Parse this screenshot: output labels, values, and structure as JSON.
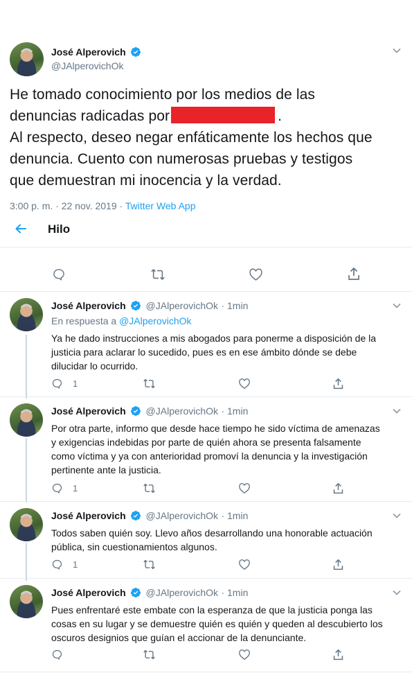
{
  "main_tweet": {
    "name": "José Alperovich",
    "handle": "@JAlperovichOk",
    "text_line1": "He tomado conocimiento por los medios de las",
    "text_line2a": "denuncias radicadas por",
    "text_line2b": ".",
    "text_line3": "Al respecto, deseo negar enfáticamente los hechos que",
    "text_line4": "denuncia. Cuento con numerosas pruebas y testigos",
    "text_line5": "que demuestran mi inocencia y  la verdad.",
    "timestamp": "3:00 p. m. · 22 nov. 2019 · ",
    "source": "Twitter Web App"
  },
  "thread_header": {
    "label": "Hilo"
  },
  "replies": [
    {
      "name": "José Alperovich",
      "handle": "@JAlperovichOk",
      "time": "· 1min",
      "in_reply_prefix": "En respuesta a ",
      "in_reply_handle": "@JAlperovichOk",
      "lines": [
        "Ya he dado instrucciones a mis abogados para ponerme a disposición de la",
        "justicia para aclarar lo sucedido, pues es en ese ámbito dónde se debe",
        "dilucidar lo ocurrido."
      ],
      "reply_count": "1"
    },
    {
      "name": "José Alperovich",
      "handle": "@JAlperovichOk",
      "time": "· 1min",
      "lines": [
        "Por otra parte, informo que desde hace tiempo he sido víctima de amenazas",
        "y exigencias indebidas por parte de quién ahora se presenta falsamente",
        "como víctima y ya con anterioridad promoví la denuncia y la investigación",
        "pertinente ante la justicia."
      ],
      "reply_count": "1"
    },
    {
      "name": "José Alperovich",
      "handle": "@JAlperovichOk",
      "time": "· 1min",
      "lines": [
        "Todos saben quién soy. Llevo años desarrollando una honorable actuación",
        "pública, sin cuestionamientos algunos."
      ],
      "reply_count": "1"
    },
    {
      "name": "José Alperovich",
      "handle": "@JAlperovichOk",
      "time": "· 1min",
      "lines": [
        "Pues enfrentaré este embate con la esperanza de que la justicia ponga las",
        "cosas en su lugar y se demuestre quién es quién y queden al descubierto los",
        "oscuros designios que guían el accionar de la denunciante."
      ],
      "reply_count": ""
    }
  ],
  "icons": {
    "verified": "verified-badge-icon",
    "chevron": "chevron-down-icon",
    "back": "back-arrow-icon",
    "reply": "reply-icon",
    "retweet": "retweet-icon",
    "like": "like-icon",
    "share": "share-icon"
  },
  "colors": {
    "accent": "#1da1f2",
    "redaction": "#e8232a",
    "muted": "#657786"
  }
}
